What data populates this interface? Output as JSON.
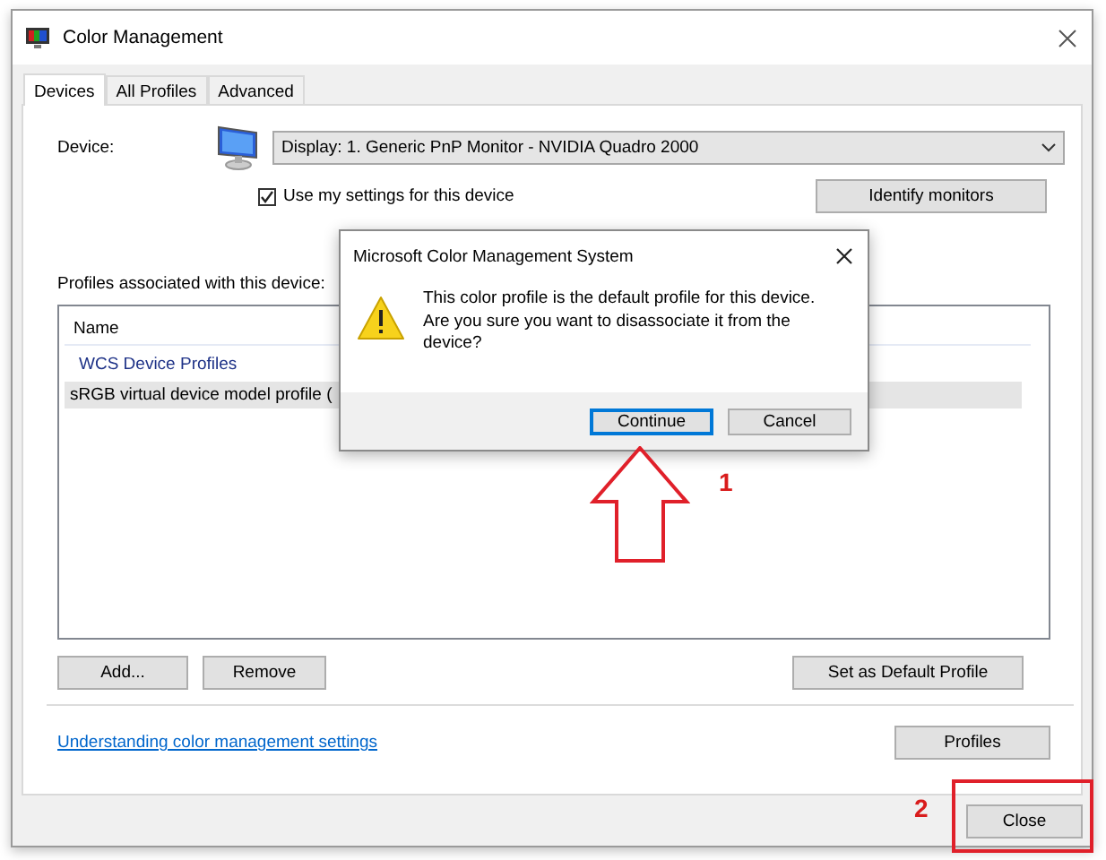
{
  "window": {
    "title": "Color Management"
  },
  "tabs": [
    {
      "label": "Devices",
      "selected": true
    },
    {
      "label": "All Profiles",
      "selected": false
    },
    {
      "label": "Advanced",
      "selected": false
    }
  ],
  "device": {
    "label": "Device:",
    "value": "Display: 1. Generic PnP Monitor - NVIDIA Quadro 2000"
  },
  "use_my_settings": {
    "label": "Use my settings for this device",
    "checked": true
  },
  "identify_button": "Identify monitors",
  "profiles": {
    "label": "Profiles associated with this device:",
    "column": "Name",
    "group": "WCS Device Profiles",
    "rows": [
      {
        "text": "sRGB virtual device model profile (",
        "selected": true
      }
    ]
  },
  "list_buttons": [
    "Add...",
    "Remove",
    "Set as Default Profile"
  ],
  "link": "Understanding color management settings",
  "profiles_button": "Profiles",
  "close_button": "Close",
  "dialog": {
    "title": "Microsoft Color Management System",
    "message": "This color profile is the default profile for this device. Are you sure you want to disassociate it from the device?",
    "buttons": [
      {
        "label": "Continue",
        "default": true
      },
      {
        "label": "Cancel",
        "default": false
      }
    ]
  },
  "annotations": [
    {
      "label": "1"
    },
    {
      "label": "2"
    }
  ]
}
